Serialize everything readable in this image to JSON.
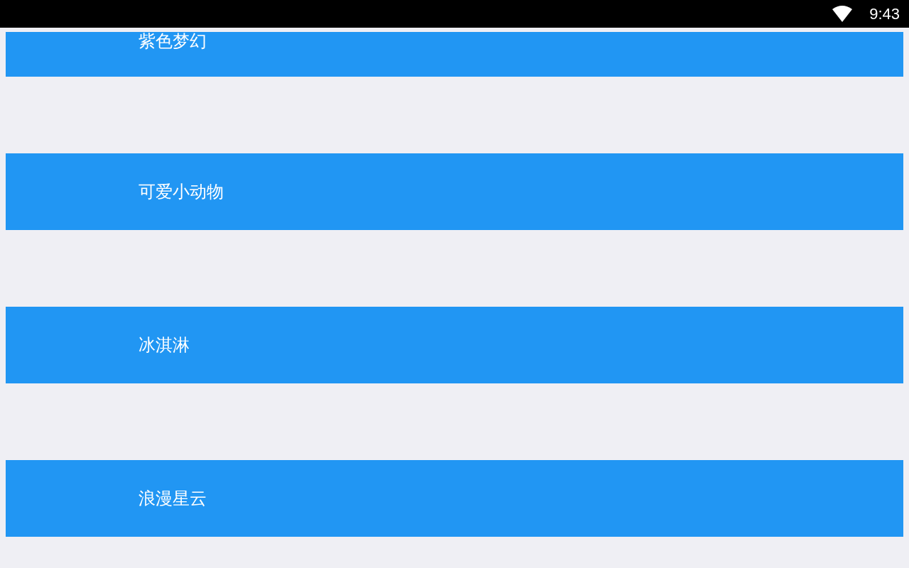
{
  "status_bar": {
    "time": "9:43"
  },
  "list": {
    "items": [
      {
        "label": "紫色梦幻"
      },
      {
        "label": "可爱小动物"
      },
      {
        "label": "冰淇淋"
      },
      {
        "label": "浪漫星云"
      }
    ]
  }
}
